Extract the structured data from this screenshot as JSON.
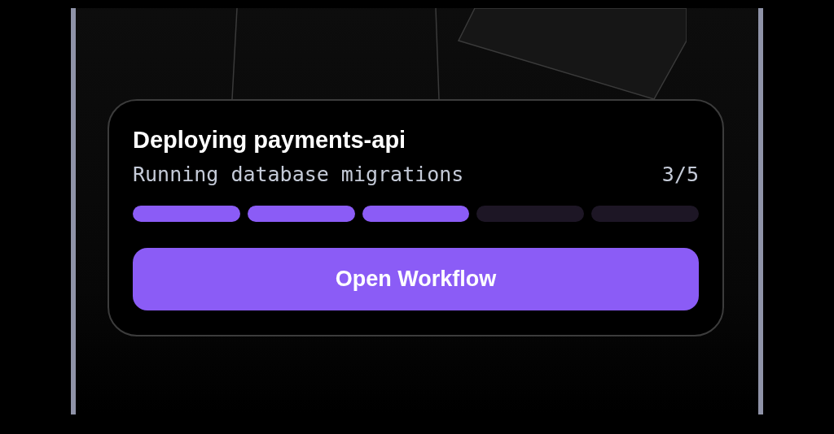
{
  "activity": {
    "title": "Deploying payments-api",
    "status": "Running database migrations",
    "count": "3/5",
    "steps": [
      {
        "done": true
      },
      {
        "done": true
      },
      {
        "done": true
      },
      {
        "done": false
      },
      {
        "done": false
      }
    ],
    "button": "Open Workflow"
  }
}
